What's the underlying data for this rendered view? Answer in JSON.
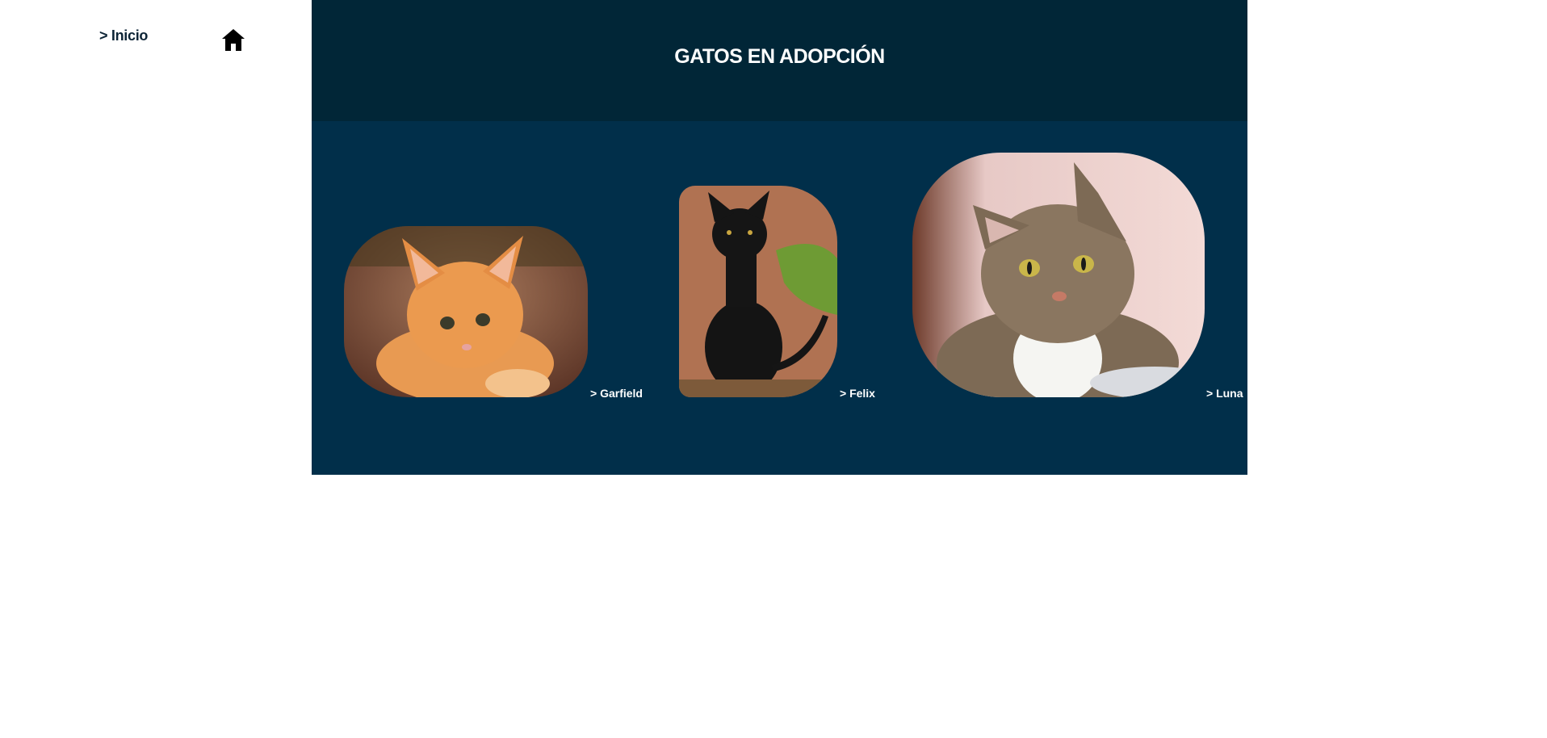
{
  "nav": {
    "home_label": "> Inicio",
    "home_icon": "home-icon"
  },
  "header": {
    "title": "GATOS EN ADOPCIÓN"
  },
  "cats": [
    {
      "name": "> Garfield",
      "photo": "orange tabby kitten"
    },
    {
      "name": "> Felix",
      "photo": "black cat"
    },
    {
      "name": "> Luna",
      "photo": "brown tabby cat"
    }
  ],
  "colors": {
    "panel_bg": "#012f4a",
    "header_bg": "#012637",
    "nav_text": "#0d2436",
    "label_text": "#ffffff"
  }
}
